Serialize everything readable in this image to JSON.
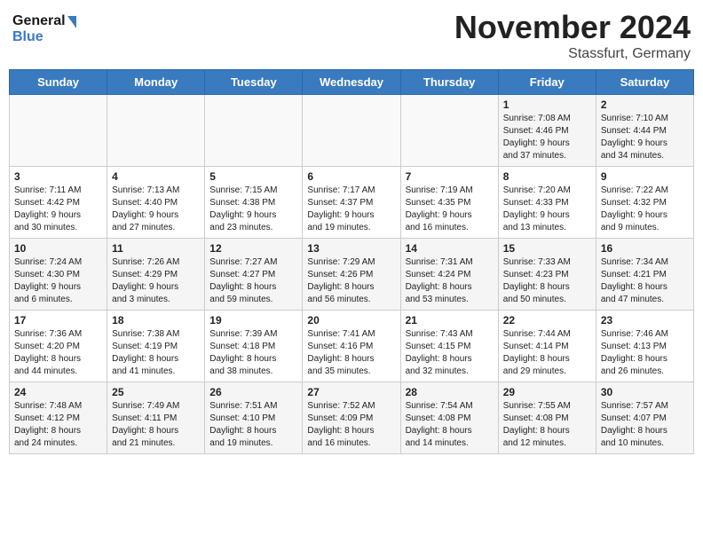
{
  "logo": {
    "line1": "General",
    "line2": "Blue"
  },
  "title": "November 2024",
  "location": "Stassfurt, Germany",
  "days_of_week": [
    "Sunday",
    "Monday",
    "Tuesday",
    "Wednesday",
    "Thursday",
    "Friday",
    "Saturday"
  ],
  "weeks": [
    [
      {
        "day": "",
        "info": ""
      },
      {
        "day": "",
        "info": ""
      },
      {
        "day": "",
        "info": ""
      },
      {
        "day": "",
        "info": ""
      },
      {
        "day": "",
        "info": ""
      },
      {
        "day": "1",
        "info": "Sunrise: 7:08 AM\nSunset: 4:46 PM\nDaylight: 9 hours\nand 37 minutes."
      },
      {
        "day": "2",
        "info": "Sunrise: 7:10 AM\nSunset: 4:44 PM\nDaylight: 9 hours\nand 34 minutes."
      }
    ],
    [
      {
        "day": "3",
        "info": "Sunrise: 7:11 AM\nSunset: 4:42 PM\nDaylight: 9 hours\nand 30 minutes."
      },
      {
        "day": "4",
        "info": "Sunrise: 7:13 AM\nSunset: 4:40 PM\nDaylight: 9 hours\nand 27 minutes."
      },
      {
        "day": "5",
        "info": "Sunrise: 7:15 AM\nSunset: 4:38 PM\nDaylight: 9 hours\nand 23 minutes."
      },
      {
        "day": "6",
        "info": "Sunrise: 7:17 AM\nSunset: 4:37 PM\nDaylight: 9 hours\nand 19 minutes."
      },
      {
        "day": "7",
        "info": "Sunrise: 7:19 AM\nSunset: 4:35 PM\nDaylight: 9 hours\nand 16 minutes."
      },
      {
        "day": "8",
        "info": "Sunrise: 7:20 AM\nSunset: 4:33 PM\nDaylight: 9 hours\nand 13 minutes."
      },
      {
        "day": "9",
        "info": "Sunrise: 7:22 AM\nSunset: 4:32 PM\nDaylight: 9 hours\nand 9 minutes."
      }
    ],
    [
      {
        "day": "10",
        "info": "Sunrise: 7:24 AM\nSunset: 4:30 PM\nDaylight: 9 hours\nand 6 minutes."
      },
      {
        "day": "11",
        "info": "Sunrise: 7:26 AM\nSunset: 4:29 PM\nDaylight: 9 hours\nand 3 minutes."
      },
      {
        "day": "12",
        "info": "Sunrise: 7:27 AM\nSunset: 4:27 PM\nDaylight: 8 hours\nand 59 minutes."
      },
      {
        "day": "13",
        "info": "Sunrise: 7:29 AM\nSunset: 4:26 PM\nDaylight: 8 hours\nand 56 minutes."
      },
      {
        "day": "14",
        "info": "Sunrise: 7:31 AM\nSunset: 4:24 PM\nDaylight: 8 hours\nand 53 minutes."
      },
      {
        "day": "15",
        "info": "Sunrise: 7:33 AM\nSunset: 4:23 PM\nDaylight: 8 hours\nand 50 minutes."
      },
      {
        "day": "16",
        "info": "Sunrise: 7:34 AM\nSunset: 4:21 PM\nDaylight: 8 hours\nand 47 minutes."
      }
    ],
    [
      {
        "day": "17",
        "info": "Sunrise: 7:36 AM\nSunset: 4:20 PM\nDaylight: 8 hours\nand 44 minutes."
      },
      {
        "day": "18",
        "info": "Sunrise: 7:38 AM\nSunset: 4:19 PM\nDaylight: 8 hours\nand 41 minutes."
      },
      {
        "day": "19",
        "info": "Sunrise: 7:39 AM\nSunset: 4:18 PM\nDaylight: 8 hours\nand 38 minutes."
      },
      {
        "day": "20",
        "info": "Sunrise: 7:41 AM\nSunset: 4:16 PM\nDaylight: 8 hours\nand 35 minutes."
      },
      {
        "day": "21",
        "info": "Sunrise: 7:43 AM\nSunset: 4:15 PM\nDaylight: 8 hours\nand 32 minutes."
      },
      {
        "day": "22",
        "info": "Sunrise: 7:44 AM\nSunset: 4:14 PM\nDaylight: 8 hours\nand 29 minutes."
      },
      {
        "day": "23",
        "info": "Sunrise: 7:46 AM\nSunset: 4:13 PM\nDaylight: 8 hours\nand 26 minutes."
      }
    ],
    [
      {
        "day": "24",
        "info": "Sunrise: 7:48 AM\nSunset: 4:12 PM\nDaylight: 8 hours\nand 24 minutes."
      },
      {
        "day": "25",
        "info": "Sunrise: 7:49 AM\nSunset: 4:11 PM\nDaylight: 8 hours\nand 21 minutes."
      },
      {
        "day": "26",
        "info": "Sunrise: 7:51 AM\nSunset: 4:10 PM\nDaylight: 8 hours\nand 19 minutes."
      },
      {
        "day": "27",
        "info": "Sunrise: 7:52 AM\nSunset: 4:09 PM\nDaylight: 8 hours\nand 16 minutes."
      },
      {
        "day": "28",
        "info": "Sunrise: 7:54 AM\nSunset: 4:08 PM\nDaylight: 8 hours\nand 14 minutes."
      },
      {
        "day": "29",
        "info": "Sunrise: 7:55 AM\nSunset: 4:08 PM\nDaylight: 8 hours\nand 12 minutes."
      },
      {
        "day": "30",
        "info": "Sunrise: 7:57 AM\nSunset: 4:07 PM\nDaylight: 8 hours\nand 10 minutes."
      }
    ]
  ]
}
